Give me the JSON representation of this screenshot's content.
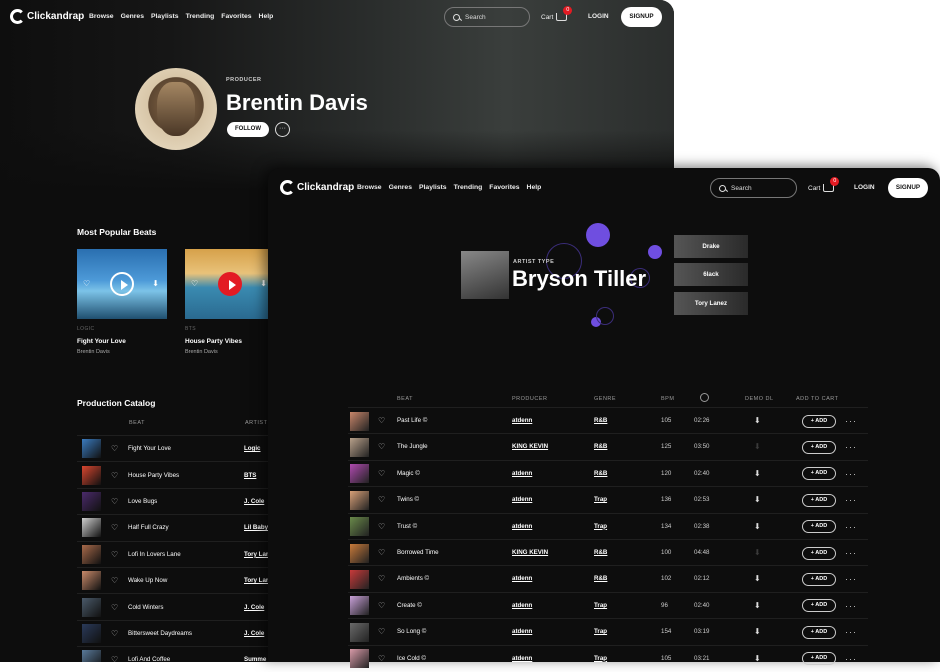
{
  "nav": {
    "logo_text": "Clickandrap",
    "links": [
      "Browse",
      "Genres",
      "Playlists",
      "Trending",
      "Favorites",
      "Help"
    ],
    "search_placeholder": "Search",
    "cart_label": "Cart",
    "cart_count": "0",
    "login_label": "LOGIN",
    "signup_label": "SIGNUP"
  },
  "producer_page": {
    "role": "PRODUCER",
    "name": "Brentin Davis",
    "follow_label": "FOLLOW",
    "more_label": "···",
    "popular_title": "Most Popular Beats",
    "popular_beats": [
      {
        "genre": "LOGIC",
        "title": "Fight Your Love",
        "artist": "Brentin Davis"
      },
      {
        "genre": "BTS",
        "title": "House Party Vibes",
        "artist": "Brentin Davis"
      }
    ],
    "catalog_title": "Production Catalog",
    "catalog_columns": {
      "beat": "BEAT",
      "artist": "ARTIST"
    },
    "catalog": [
      {
        "title": "Fight Your Love",
        "artist": "Logic",
        "color": "#3a7bbf"
      },
      {
        "title": "House Party Vibes",
        "artist": "BTS",
        "color": "#d8462f"
      },
      {
        "title": "Love Bugs",
        "artist": "J. Cole",
        "color": "#4a2a6b"
      },
      {
        "title": "Half Full Crazy",
        "artist": "Lil Baby",
        "color": "#cfcfcf"
      },
      {
        "title": "Lofi In Lovers Lane",
        "artist": "Tory Lan",
        "color": "#a86a4a"
      },
      {
        "title": "Wake Up Now",
        "artist": "Tory Lan",
        "color": "#c98a6a"
      },
      {
        "title": "Cold Winters",
        "artist": "J. Cole",
        "color": "#4a5a6a"
      },
      {
        "title": "Bittersweet Daydreams",
        "artist": "J. Cole",
        "color": "#2a3a5a"
      },
      {
        "title": "Lofi And Coffee",
        "artist": "Summe",
        "color": "#5a7a9a"
      }
    ]
  },
  "artist_page": {
    "role": "ARTIST TYPE",
    "name": "Bryson Tiller",
    "related": [
      "Drake",
      "6lack",
      "Tory Lanez"
    ],
    "columns": {
      "beat": "BEAT",
      "producer": "PRODUCER",
      "genre": "GENRE",
      "bpm": "BPM",
      "demo": "DEMO DL",
      "cart": "ADD TO CART"
    },
    "add_label": "+ ADD",
    "rows": [
      {
        "title": "Past Life ©",
        "producer": "atdenn",
        "genre": "R&B",
        "bpm": "105",
        "duration": "02:26",
        "demo": true,
        "color": "#c8866a"
      },
      {
        "title": "The Jungle",
        "producer": "KING KEVIN",
        "genre": "R&B",
        "bpm": "125",
        "duration": "03:50",
        "demo": false,
        "color": "#b8a08a"
      },
      {
        "title": "Magic ©",
        "producer": "atdenn",
        "genre": "R&B",
        "bpm": "120",
        "duration": "02:40",
        "demo": true,
        "color": "#b04ab0"
      },
      {
        "title": "Twins ©",
        "producer": "atdenn",
        "genre": "Trap",
        "bpm": "136",
        "duration": "02:53",
        "demo": true,
        "color": "#d8a078"
      },
      {
        "title": "Trust ©",
        "producer": "atdenn",
        "genre": "Trap",
        "bpm": "134",
        "duration": "02:38",
        "demo": true,
        "color": "#6a8a4a"
      },
      {
        "title": "Borrowed Time",
        "producer": "KING KEVIN",
        "genre": "R&B",
        "bpm": "100",
        "duration": "04:48",
        "demo": false,
        "color": "#c87a3a"
      },
      {
        "title": "Ambients ©",
        "producer": "atdenn",
        "genre": "R&B",
        "bpm": "102",
        "duration": "02:12",
        "demo": true,
        "color": "#c83a3a"
      },
      {
        "title": "Create ©",
        "producer": "atdenn",
        "genre": "Trap",
        "bpm": "96",
        "duration": "02:40",
        "demo": true,
        "color": "#c8a0d8"
      },
      {
        "title": "So Long ©",
        "producer": "atdenn",
        "genre": "Trap",
        "bpm": "154",
        "duration": "03:19",
        "demo": true,
        "color": "#6a6a6a"
      },
      {
        "title": "Ice Cold ©",
        "producer": "atdenn",
        "genre": "Trap",
        "bpm": "105",
        "duration": "03:21",
        "demo": true,
        "color": "#d89aa8"
      }
    ]
  }
}
